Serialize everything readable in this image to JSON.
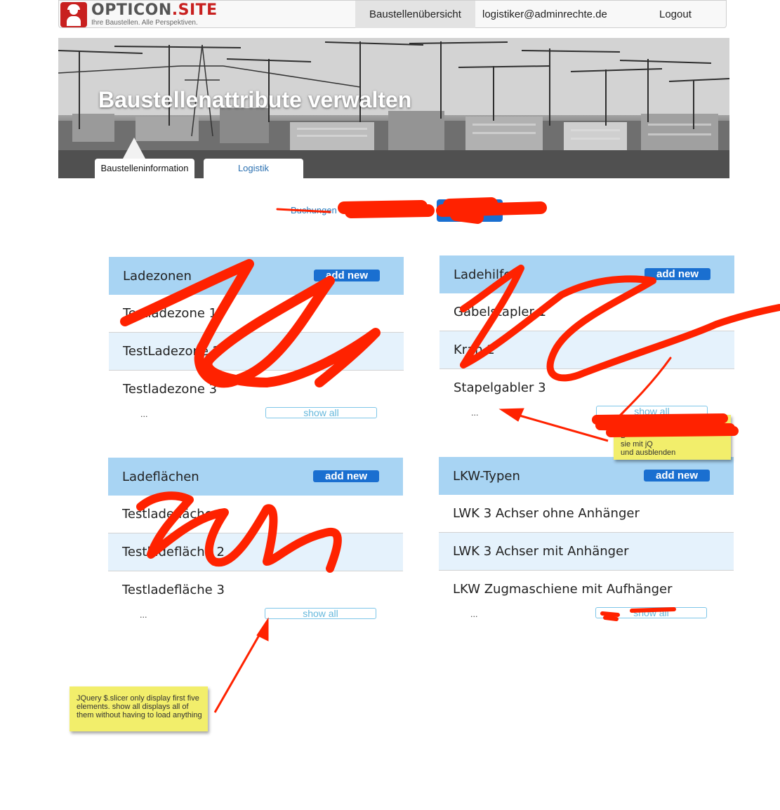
{
  "brand": {
    "name_part1": "OPTICON",
    "name_part2": ".SITE",
    "tagline": "Ihre Baustellen. Alle Perspektiven."
  },
  "nav": {
    "overview": "Baustellenübersicht",
    "user": "logistiker@adminrechte.de",
    "logout": "Logout"
  },
  "hero": {
    "title": "Baustellenattribute verwalten"
  },
  "tabs": [
    {
      "label": "Baustelleninformation"
    },
    {
      "label": "Logistik"
    }
  ],
  "subnav": {
    "first_link": "Buchungen"
  },
  "panels": [
    {
      "title": "Ladezonen",
      "add_label": "add new",
      "items": [
        "Testladezone 1",
        "TestLadezone 2",
        "Testladezone 3"
      ],
      "ellipsis": "...",
      "show_all": "show all"
    },
    {
      "title": "Ladehilfen",
      "add_label": "add new",
      "items": [
        "Gabelstapler 1",
        "Kran 2",
        "Stapelgabler 3"
      ],
      "ellipsis": "...",
      "show_all": "show all"
    },
    {
      "title": "Ladeflächen",
      "add_label": "add new",
      "items": [
        "Testladefläche 1",
        "Testladefläche 2",
        "Testladefläche 3"
      ],
      "ellipsis": "...",
      "show_all": "show all"
    },
    {
      "title": "LKW-Typen",
      "add_label": "add new",
      "items": [
        "LWK 3 Achser ohne Anhänger",
        "LWK 3 Achser mit Anhänger",
        "LKW Zugmaschiene mit Aufhänger"
      ],
      "ellipsis": "...",
      "show_all": "show all"
    }
  ],
  "notes": {
    "slicer": "JQuery $.slicer only display first five elements. show all displays all of them without having to load anything",
    "toggle_line1": "B",
    "toggle_line2": "sie mit jQ",
    "toggle_line3": "und ausblenden"
  },
  "colors": {
    "accent": "#1a6fd0",
    "panel_header": "#a8d4f3",
    "row_alt": "#e5f2fc",
    "scribble": "#ff2200",
    "note": "#f2ee6b"
  }
}
